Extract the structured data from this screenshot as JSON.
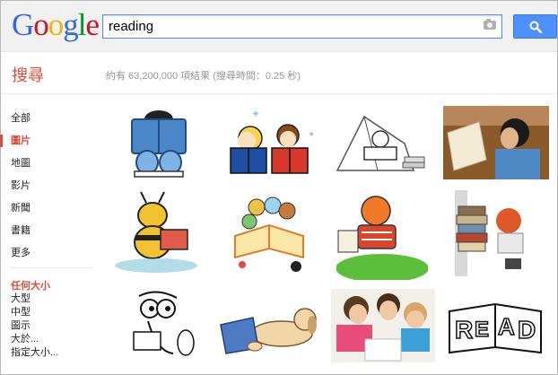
{
  "brand": {
    "logo_letters": [
      {
        "ch": "G",
        "color": "#3369e8"
      },
      {
        "ch": "o",
        "color": "#d50f25"
      },
      {
        "ch": "o",
        "color": "#eeb211"
      },
      {
        "ch": "g",
        "color": "#3369e8"
      },
      {
        "ch": "l",
        "color": "#009925"
      },
      {
        "ch": "e",
        "color": "#d50f25"
      }
    ]
  },
  "search": {
    "query": "reading"
  },
  "header": {
    "title": "搜尋",
    "stats": "約有 63,200,000 項結果 (搜尋時間：0.25 秒)"
  },
  "sidebar": {
    "items": [
      {
        "label": "全部"
      },
      {
        "label": "圖片",
        "active": true
      },
      {
        "label": "地圖"
      },
      {
        "label": "影片"
      },
      {
        "label": "新聞"
      },
      {
        "label": "書籍"
      },
      {
        "label": "更多"
      }
    ],
    "size_filter": {
      "title": "任何大小",
      "options": [
        "大型",
        "中型",
        "圖示",
        "大於...",
        "指定大小..."
      ]
    }
  },
  "colors": {
    "accent_red": "#dd4b39",
    "search_blue": "#4d90fe"
  },
  "results": [
    {
      "name": "boy-reading-blue-book"
    },
    {
      "name": "two-kids-reading-books"
    },
    {
      "name": "child-reading-in-tent-sketch"
    },
    {
      "name": "girl-reading-photo"
    },
    {
      "name": "bee-reading-book"
    },
    {
      "name": "kids-reading-big-book"
    },
    {
      "name": "boy-reading-on-grass"
    },
    {
      "name": "girl-with-book-stack"
    },
    {
      "name": "bird-reading-cartoon"
    },
    {
      "name": "dog-reading-book"
    },
    {
      "name": "children-reading-photo"
    },
    {
      "name": "read-open-book"
    }
  ]
}
